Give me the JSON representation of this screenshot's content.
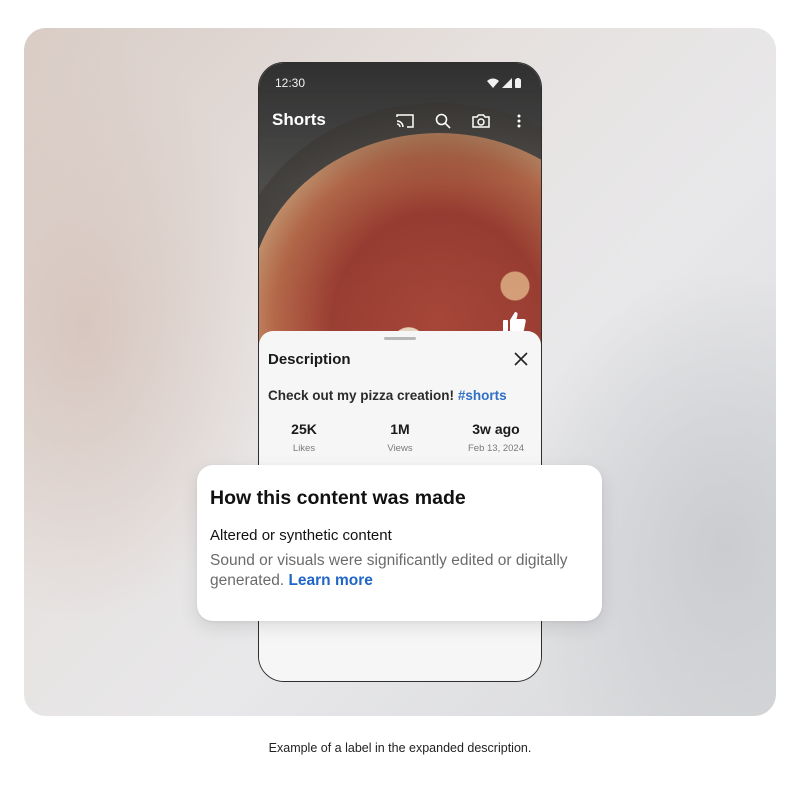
{
  "status_bar": {
    "time": "12:30"
  },
  "header": {
    "title": "Shorts",
    "icons": [
      "cast-icon",
      "search-icon",
      "camera-icon",
      "more-vert-icon"
    ]
  },
  "description_sheet": {
    "title": "Description",
    "text": "Check out my pizza creation!",
    "hashtag": "#shorts",
    "stats": [
      {
        "value": "25K",
        "label": "Likes"
      },
      {
        "value": "1M",
        "label": "Views"
      },
      {
        "value": "3w ago",
        "label": "Feb 13, 2024"
      }
    ]
  },
  "popup": {
    "title": "How this content was made",
    "subtitle": "Altered or synthetic content",
    "body": "Sound or visuals were significantly edited or digitally generated.",
    "link": "Learn more"
  },
  "caption": "Example of a label in the expanded description.",
  "colors": {
    "link": "#1f66c6",
    "hashtag": "#2f6fc4",
    "text": "#111111",
    "muted": "#6b6b6b"
  }
}
